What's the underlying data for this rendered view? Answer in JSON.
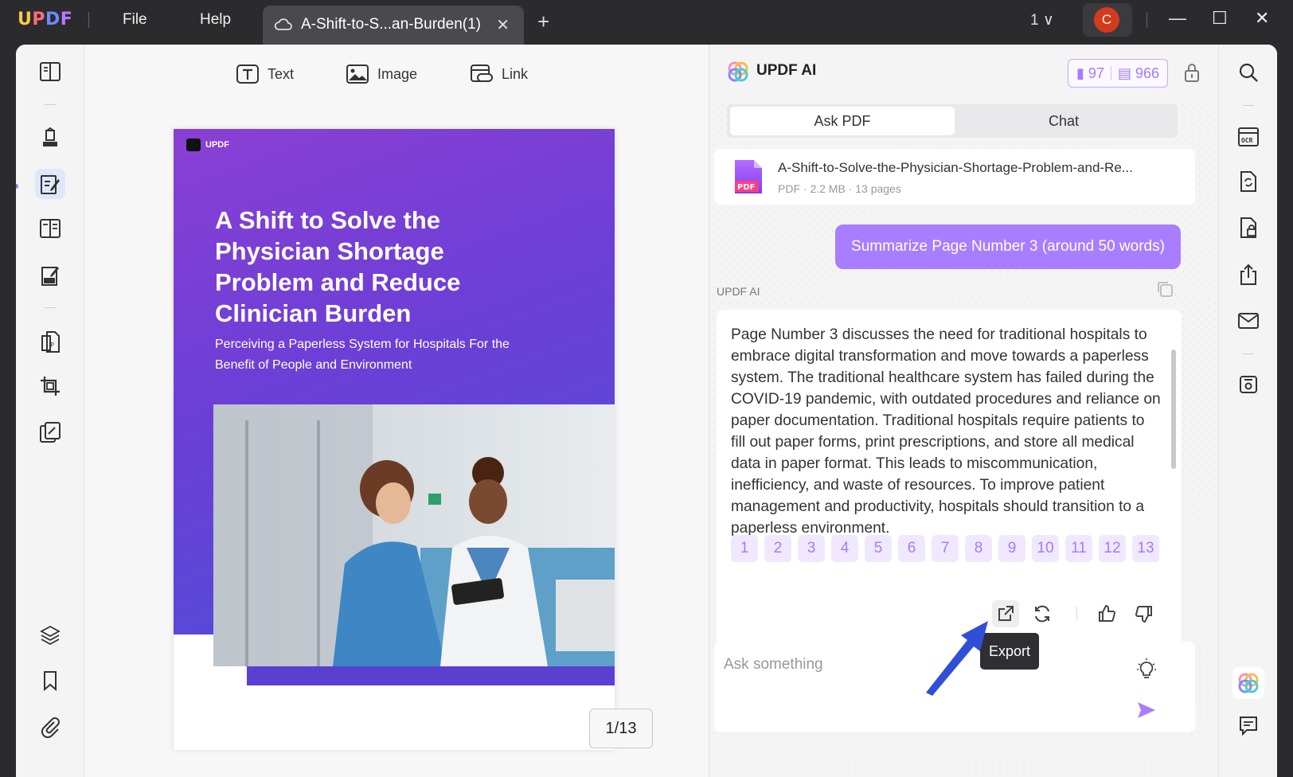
{
  "titlebar": {
    "logo": {
      "u": "U",
      "p": "P",
      "d": "D",
      "f": "F"
    },
    "menu": [
      "File",
      "Help"
    ],
    "tab_title": "A-Shift-to-S...an-Burden(1)",
    "tab_close": "✕",
    "new_tab": "+",
    "page_selector": "1 ∨",
    "avatar_initial": "C",
    "window_controls": {
      "minimize": "—",
      "maximize": "☐",
      "close": "✕"
    }
  },
  "left_rail": {
    "icons": [
      "reader-icon",
      "comment-icon",
      "edit-pdf-icon",
      "organize-pages-icon",
      "form-icon",
      "convert-icon",
      "crop-icon",
      "watermark-icon",
      "layers-icon",
      "bookmark-icon",
      "attachment-icon"
    ],
    "active": "edit-pdf-icon"
  },
  "edit_toolbar": {
    "text": "Text",
    "image": "Image",
    "link": "Link"
  },
  "document": {
    "brand": "UPDF",
    "title": "A Shift to Solve the Physician Shortage Problem and Reduce Clinician Burden",
    "subtitle": "Perceiving a Paperless System for Hospitals For the Benefit of People and Environment",
    "page_indicator": "1/13"
  },
  "ai_panel": {
    "title": "UPDF AI",
    "credits": {
      "pages": "97",
      "messages": "966"
    },
    "tabs": {
      "ask_pdf": "Ask PDF",
      "chat": "Chat"
    },
    "file": {
      "name": "A-Shift-to-Solve-the-Physician-Shortage-Problem-and-Re...",
      "meta": "PDF · 2.2 MB · 13 pages",
      "badge": "PDF"
    },
    "user_prompt": "Summarize Page Number 3 (around 50 words)",
    "ai_label": "UPDF AI",
    "answer": "Page Number 3 discusses the need for traditional hospitals to embrace digital transformation and move towards a paperless system. The traditional healthcare system has failed during the COVID-19 pandemic, with outdated procedures and reliance on paper documentation. Traditional hospitals require patients to fill out paper forms, print prescriptions, and store all medical data in paper format. This leads to miscommunication, inefficiency, and waste of resources. To improve patient management and productivity, hospitals should transition to a paperless environment.",
    "page_chips": [
      "1",
      "2",
      "3",
      "4",
      "5",
      "6",
      "7",
      "8",
      "9",
      "10",
      "11",
      "12",
      "13"
    ],
    "tooltip": "Export",
    "input_placeholder": "Ask something"
  },
  "right_rail": {
    "icons": [
      "search-icon",
      "ocr-icon",
      "convert-icon",
      "protect-icon",
      "share-icon",
      "email-icon",
      "save-icon",
      "updf-ai-icon",
      "comments-list-icon"
    ],
    "ocr_label": "OCR"
  },
  "colors": {
    "accent": "#a97dff",
    "cover_top": "#8a3fd4",
    "cover_bottom": "#4c4fd8",
    "arrow": "#2f4fd8",
    "avatar": "#d43a1c"
  }
}
